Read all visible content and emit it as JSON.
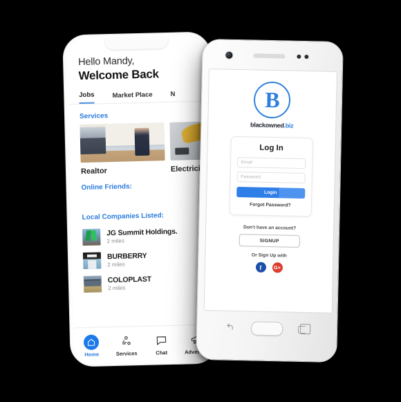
{
  "background_color": "#000000",
  "accent_blue": "#2a7bdc",
  "left_phone": {
    "device": "iphone-mockup",
    "greeting": {
      "line1": "Hello Mandy,",
      "line2": "Welcome Back"
    },
    "tabs": [
      {
        "label": "Jobs",
        "active": true
      },
      {
        "label": "Market Place",
        "active": false
      },
      {
        "label": "N",
        "active": false
      }
    ],
    "sections": {
      "services_title": "Services",
      "online_friends_title": "Online Friends:",
      "local_companies_title": "Local Companies Listed:"
    },
    "services": [
      {
        "label": "Realtor",
        "image": "realtor-photo"
      },
      {
        "label": "Electrici",
        "image": "electrician-photo"
      }
    ],
    "companies": [
      {
        "name": "JG Summit Holdings.",
        "distance": "2 miles",
        "thumb": "jg-summit-thumb"
      },
      {
        "name": "BURBERRY",
        "distance": "2 miles",
        "thumb": "burberry-thumb"
      },
      {
        "name": "COLOPLAST",
        "distance": "2 miles",
        "thumb": "coloplast-thumb"
      }
    ],
    "bottom_nav": [
      {
        "label": "Home",
        "icon": "home-icon",
        "active": true
      },
      {
        "label": "Services",
        "icon": "services-icon",
        "active": false
      },
      {
        "label": "Chat",
        "icon": "chat-icon",
        "active": false
      },
      {
        "label": "Advertise",
        "icon": "megaphone-icon",
        "active": false
      }
    ]
  },
  "right_phone": {
    "device": "samsung-mockup",
    "logo": {
      "mark": "B",
      "name_dark": "blackowned",
      "name_blue": ".biz"
    },
    "login": {
      "title": "Log In",
      "email_placeholder": "Email",
      "password_placeholder": "Password",
      "button_label": "Login",
      "forgot_label": "Forgot Password?"
    },
    "signup": {
      "prompt": "Don't have an account?",
      "button_label": "SIGNUP",
      "or_label": "Or Sign Up with",
      "socials": [
        {
          "name": "facebook-icon",
          "glyph": "f"
        },
        {
          "name": "google-plus-icon",
          "glyph": "G+"
        }
      ]
    },
    "hardware": {
      "back_icon": "back-icon",
      "home_button": "home-button",
      "recents_icon": "recent-apps-icon"
    }
  }
}
